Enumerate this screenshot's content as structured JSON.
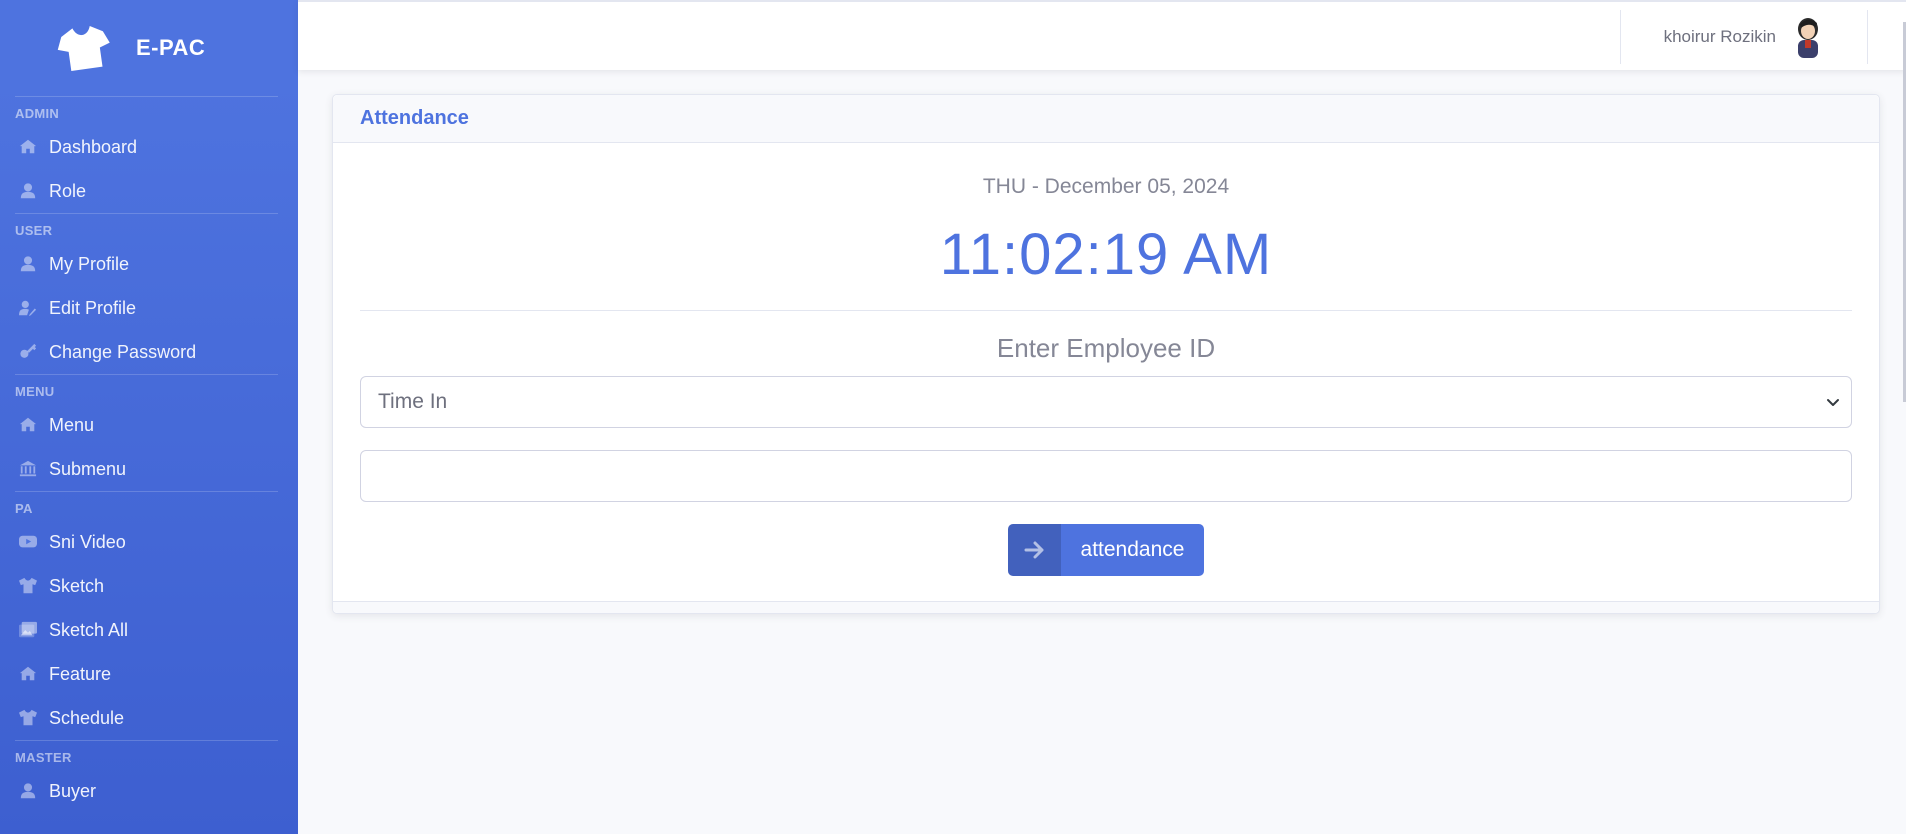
{
  "brand": {
    "name": "E-PAC",
    "logo_icon": "tshirt-icon"
  },
  "sidebar": {
    "sections": [
      {
        "heading": "ADMIN",
        "items": [
          {
            "label": "Dashboard",
            "icon": "home-icon"
          },
          {
            "label": "Role",
            "icon": "user-icon"
          }
        ]
      },
      {
        "heading": "USER",
        "items": [
          {
            "label": "My Profile",
            "icon": "user-icon"
          },
          {
            "label": "Edit Profile",
            "icon": "user-edit-icon"
          },
          {
            "label": "Change Password",
            "icon": "key-icon"
          }
        ]
      },
      {
        "heading": "MENU",
        "items": [
          {
            "label": "Menu",
            "icon": "home-icon"
          },
          {
            "label": "Submenu",
            "icon": "bank-icon"
          }
        ]
      },
      {
        "heading": "PA",
        "items": [
          {
            "label": "Sni Video",
            "icon": "youtube-icon"
          },
          {
            "label": "Sketch",
            "icon": "tshirt-icon"
          },
          {
            "label": "Sketch All",
            "icon": "images-icon"
          },
          {
            "label": "Feature",
            "icon": "home-icon"
          },
          {
            "label": "Schedule",
            "icon": "tshirt-icon"
          }
        ]
      },
      {
        "heading": "MASTER",
        "items": [
          {
            "label": "Buyer",
            "icon": "user-icon"
          }
        ]
      }
    ]
  },
  "topbar": {
    "user_name": "khoirur Rozikin",
    "avatar_icon": "avatar-icon"
  },
  "card": {
    "title": "Attendance",
    "date_line": "THU - December 05, 2024",
    "clock": "11:02:19 AM",
    "enter_label": "Enter Employee ID",
    "select_value": "Time In",
    "input_value": "",
    "button_label": "attendance",
    "button_icon": "arrow-right-icon"
  },
  "colors": {
    "primary": "#4e73df",
    "text_muted": "#858796",
    "background": "#f8f9fc"
  }
}
